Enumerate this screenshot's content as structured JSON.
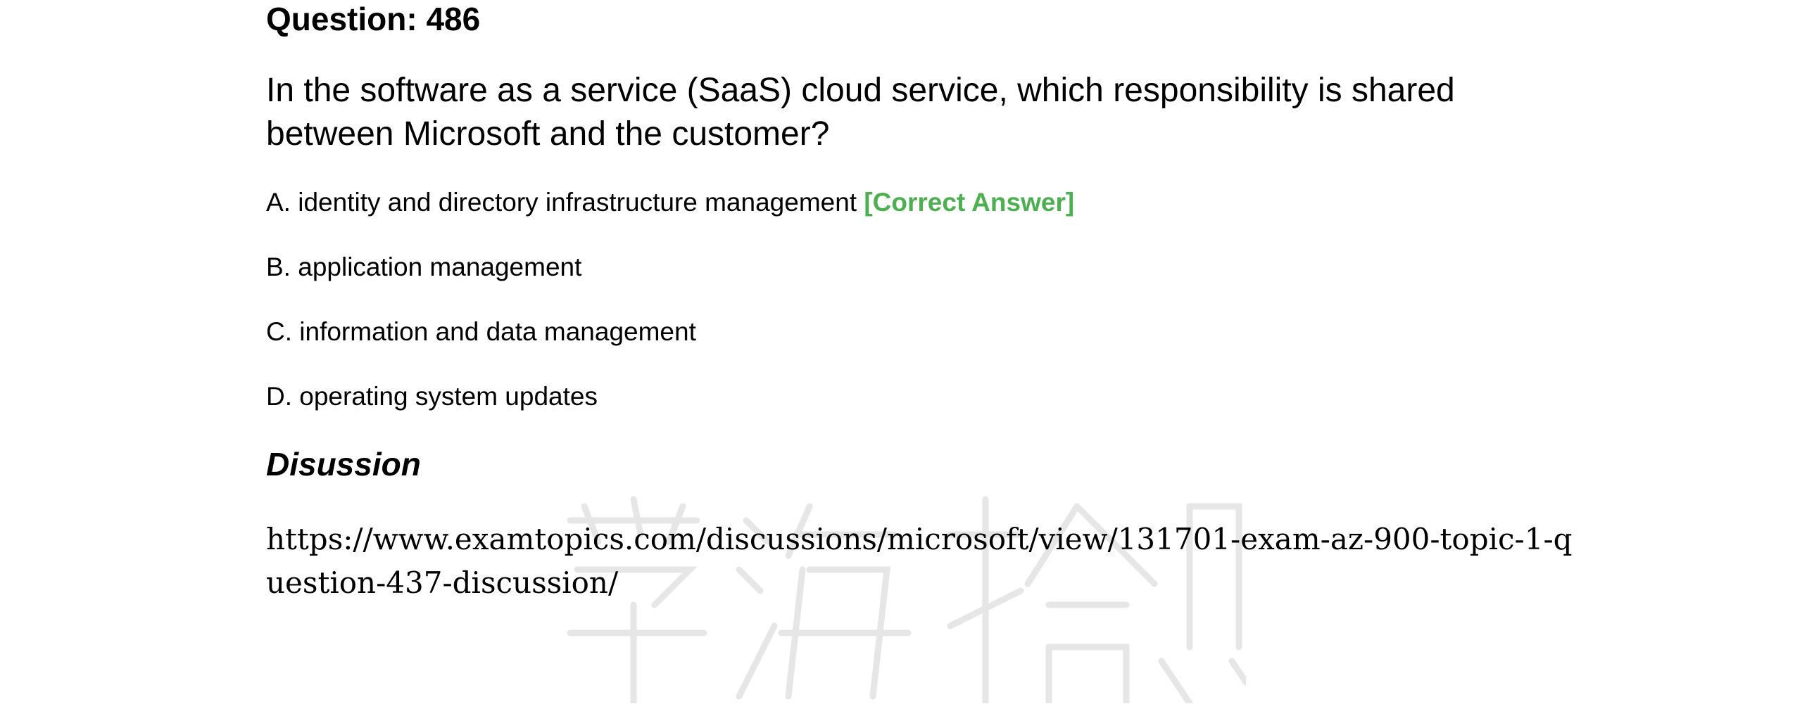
{
  "question": {
    "number_label": "Question: 486",
    "text": "In the software as a service (SaaS) cloud service, which responsibility is shared between Microsoft and the customer?"
  },
  "options": [
    {
      "text": "A. identity and directory infrastructure management",
      "tag": "[Correct Answer]"
    },
    {
      "text": "B. application management"
    },
    {
      "text": "C. information and data management"
    },
    {
      "text": "D. operating system updates"
    }
  ],
  "discussion": {
    "heading": "Disussion",
    "url": "https://www.examtopics.com/discussions/microsoft/view/131701-exam-az-900-topic-1-question-437-discussion/"
  },
  "colors": {
    "correct_answer": "#4caf50",
    "watermark": "#e6e6e6"
  }
}
